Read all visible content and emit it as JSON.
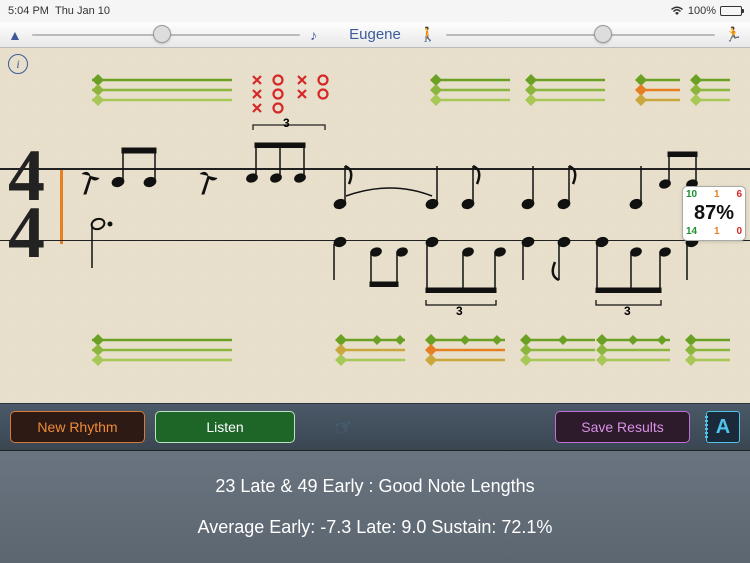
{
  "statusBar": {
    "time": "5:04 PM",
    "date": "Thu Jan 10",
    "battery": "100%"
  },
  "header": {
    "title": "Eugene"
  },
  "info": {
    "label": "i"
  },
  "timeSig": {
    "top": "4",
    "bottom": "4"
  },
  "scoreBadge": {
    "top": {
      "a": "10",
      "b": "1",
      "c": "6"
    },
    "pct": "87%",
    "bottom": {
      "a": "14",
      "b": "1",
      "c": "0"
    }
  },
  "tuplets": {
    "t1": "3",
    "t2": "3",
    "t3": "3"
  },
  "buttons": {
    "newRhythm": "New Rhythm",
    "listen": "Listen",
    "saveResults": "Save Results",
    "aBadge": "A"
  },
  "stats": {
    "line1": "23 Late & 49 Early : Good Note Lengths",
    "line2": "Average Early: -7.3 Late: 9.0 Sustain: 72.1%"
  }
}
